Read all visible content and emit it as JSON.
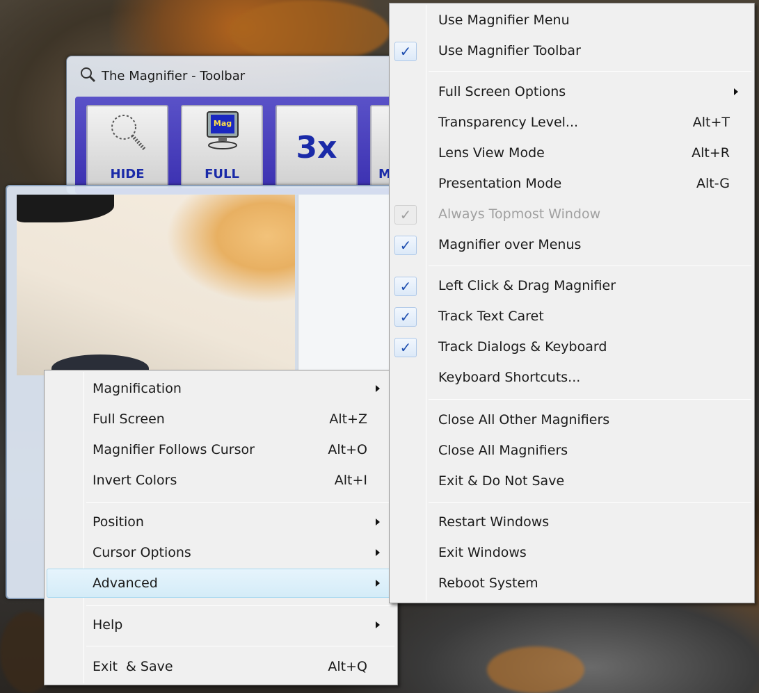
{
  "toolbar_window": {
    "title": "The Magnifier - Toolbar",
    "buttons": [
      {
        "label": "HIDE"
      },
      {
        "label": "FULL",
        "icon_text": "Mag"
      },
      {
        "label": "3x"
      },
      {
        "label": "M"
      }
    ]
  },
  "context_menu": {
    "items": [
      {
        "label": "Magnification",
        "shortcut": "",
        "submenu": true
      },
      {
        "label": "Full Screen",
        "shortcut": "Alt+Z",
        "submenu": false
      },
      {
        "label": "Magnifier Follows Cursor",
        "shortcut": "Alt+O",
        "submenu": false
      },
      {
        "label": "Invert Colors",
        "shortcut": "Alt+I",
        "submenu": false
      },
      {
        "label": "Position",
        "shortcut": "",
        "submenu": true
      },
      {
        "label": "Cursor Options",
        "shortcut": "",
        "submenu": true
      },
      {
        "label": "Advanced",
        "shortcut": "",
        "submenu": true,
        "highlighted": true
      },
      {
        "label": "Help",
        "shortcut": "",
        "submenu": true
      },
      {
        "label": "Exit  & Save",
        "shortcut": "Alt+Q",
        "submenu": false
      }
    ]
  },
  "advanced_submenu": {
    "items": [
      {
        "label": "Use Magnifier Menu",
        "checked": false
      },
      {
        "label": "Use Magnifier Toolbar",
        "checked": true
      },
      {
        "label": "Full Screen Options",
        "submenu": true
      },
      {
        "label": "Transparency Level...",
        "shortcut": "Alt+T"
      },
      {
        "label": "Lens View Mode",
        "shortcut": "Alt+R"
      },
      {
        "label": "Presentation Mode",
        "shortcut": "Alt-G"
      },
      {
        "label": "Always Topmost Window",
        "checked": true,
        "disabled": true
      },
      {
        "label": "Magnifier over Menus",
        "checked": true
      },
      {
        "label": "Left Click & Drag Magnifier",
        "checked": true
      },
      {
        "label": "Track Text Caret",
        "checked": true
      },
      {
        "label": "Track Dialogs & Keyboard",
        "checked": true
      },
      {
        "label": "Keyboard Shortcuts..."
      },
      {
        "label": "Close All Other Magnifiers"
      },
      {
        "label": "Close All Magnifiers"
      },
      {
        "label": "Exit & Do Not Save"
      },
      {
        "label": "Restart Windows"
      },
      {
        "label": "Exit Windows"
      },
      {
        "label": "Reboot System"
      }
    ]
  },
  "check_glyph": "✓",
  "colors": {
    "menu_bg": "#f0f0f0",
    "highlight": "#d4ecf8",
    "toolbar_accent": "#3a2fb0",
    "check": "#1f4fb0"
  }
}
